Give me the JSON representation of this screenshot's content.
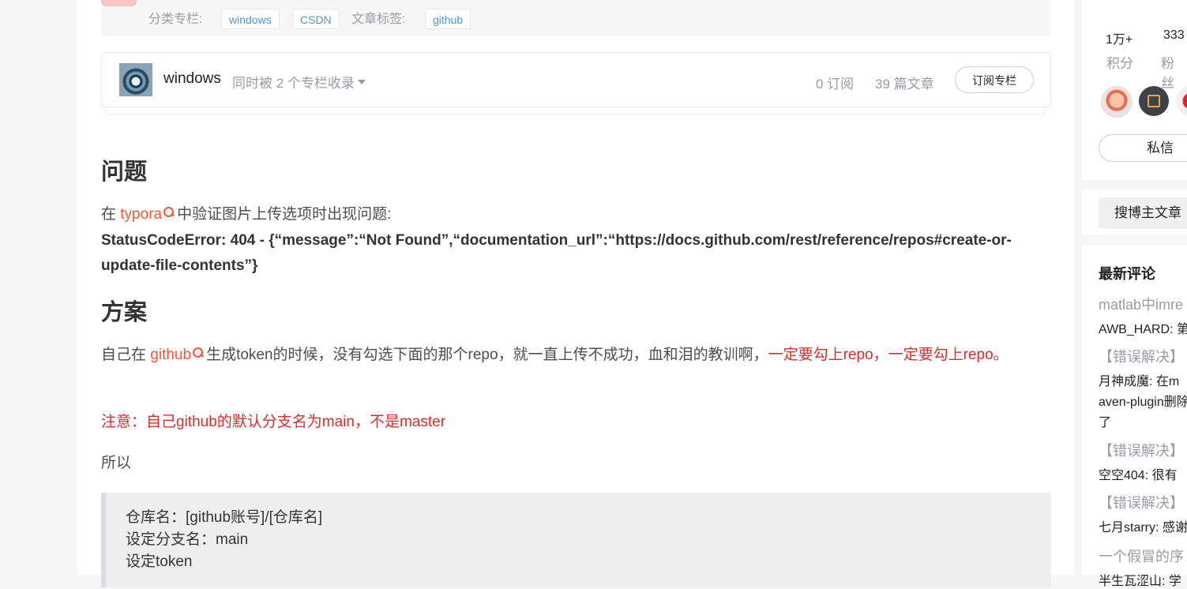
{
  "tagbar": {
    "category_label": "分类专栏:",
    "categories": [
      "windows",
      "CSDN"
    ],
    "tag_label": "文章标签:",
    "tags": [
      "github"
    ]
  },
  "column_card": {
    "name": "windows",
    "included_text": "同时被 2 个专栏收录",
    "subscriptions": "0 订阅",
    "articles": "39 篇文章",
    "subscribe_button": "订阅专栏"
  },
  "article": {
    "h_problem": "问题",
    "p1_prefix": "在 ",
    "p1_link": "typora",
    "p1_suffix": "中验证图片上传选项时出现问题:",
    "error_text": "StatusCodeError: 404 - {“message”:“Not Found”,“documentation_url”:“https://docs.github.com/rest/reference/repos#create-or-update-file-contents”}",
    "h_solution": "方案",
    "p2_prefix": "自己在 ",
    "p2_link": "github",
    "p2_middle": "生成token的时候，没有勾选下面的那个repo，就一直上传不成功，血和泪的教训啊，",
    "p2_red": "一定要勾上repo，一定要勾上repo。",
    "note": "注意：自己github的默认分支名为main，不是master",
    "so": "所以",
    "code_lines": [
      "仓库名：[github账号]/[仓库名]",
      "设定分支名：main",
      "设定token"
    ]
  },
  "sidebar": {
    "stats": [
      {
        "value": "1万+",
        "label": "积分"
      },
      {
        "value": "333",
        "label": "粉丝"
      }
    ],
    "message_button": "私信",
    "search_button": "搜博主文章",
    "recent_comments_title": "最新评论",
    "comments": [
      {
        "title": "matlab中imre",
        "body": "AWB_HARD: 第"
      },
      {
        "title": "【错误解决】",
        "body": "月神成魔: 在m",
        "extra": [
          "aven-plugin删除",
          "了"
        ]
      },
      {
        "title": "【错误解决】",
        "body": "空空404: 很有"
      },
      {
        "title": "【错误解决】",
        "body": "七月starry: 感谢"
      },
      {
        "title": "一个假冒的序",
        "body": "半生瓦涩山: 学"
      }
    ]
  },
  "colors": {
    "accent_red": "#fc5531",
    "tag_blue": "#5094d5",
    "warning_red": "#e02b2b"
  }
}
